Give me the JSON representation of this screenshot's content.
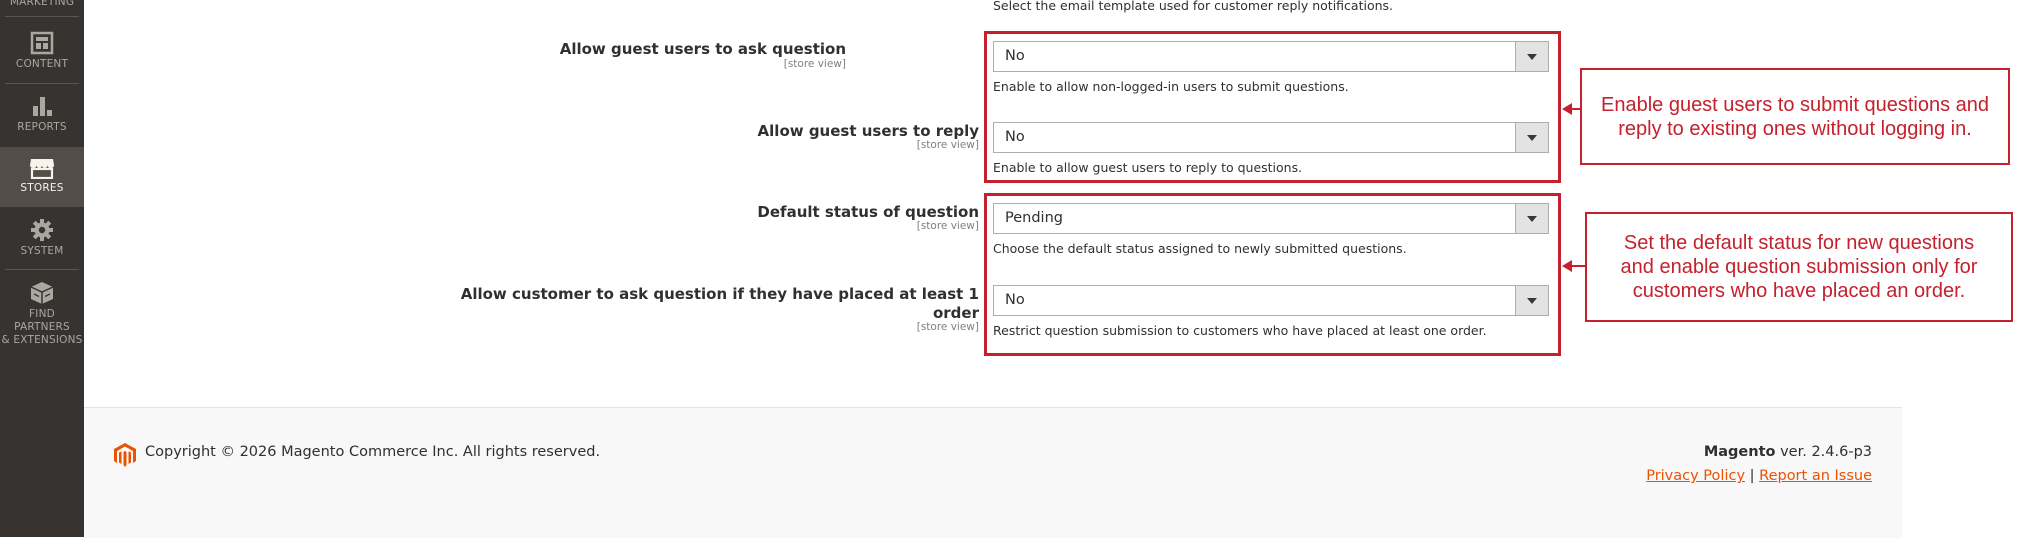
{
  "sidebar": {
    "items": [
      {
        "label": "MARKETING",
        "icon": "megaphone-icon"
      },
      {
        "label": "CONTENT",
        "icon": "content-layout-icon"
      },
      {
        "label": "REPORTS",
        "icon": "bar-chart-icon"
      },
      {
        "label": "STORES",
        "icon": "store-icon",
        "active": true
      },
      {
        "label": "SYSTEM",
        "icon": "gear-icon"
      },
      {
        "label_line1": "FIND PARTNERS",
        "label_line2": "& EXTENSIONS",
        "icon": "extensions-box-icon"
      }
    ]
  },
  "form": {
    "top_note": "Select the email template used for customer reply notifications.",
    "rows": [
      {
        "label": "Allow guest users to ask question",
        "scope": "[store view]",
        "value": "No",
        "hint": "Enable to allow non-logged-in users to submit questions."
      },
      {
        "label": "Allow guest users to reply",
        "scope": "[store view]",
        "value": "No",
        "hint": "Enable to allow guest users to reply to questions."
      },
      {
        "label": "Default status of question",
        "scope": "[store view]",
        "value": "Pending",
        "hint": "Choose the default status assigned to newly submitted questions."
      },
      {
        "label_line1": "Allow customer to ask question if they have placed at least 1",
        "label_line2": "order",
        "scope": "[store view]",
        "value": "No",
        "hint": "Restrict question submission to customers who have placed at least one order."
      }
    ]
  },
  "annotations": [
    {
      "line1": "Enable guest users to submit questions and",
      "line2": "reply to existing ones without logging in."
    },
    {
      "line1": "Set the default status for new questions",
      "line2": "and enable question submission only for",
      "line3": "customers who have placed an order."
    }
  ],
  "footer": {
    "copyright": "Copyright © 2026 Magento Commerce Inc. All rights reserved.",
    "brand": "Magento",
    "version": " ver. 2.4.6-p3",
    "privacy": "Privacy Policy",
    "separator": " | ",
    "report": "Report an Issue"
  },
  "colors": {
    "sidebar_bg": "#373330",
    "annotation_red": "#c4202e",
    "link_orange": "#eb5202"
  }
}
